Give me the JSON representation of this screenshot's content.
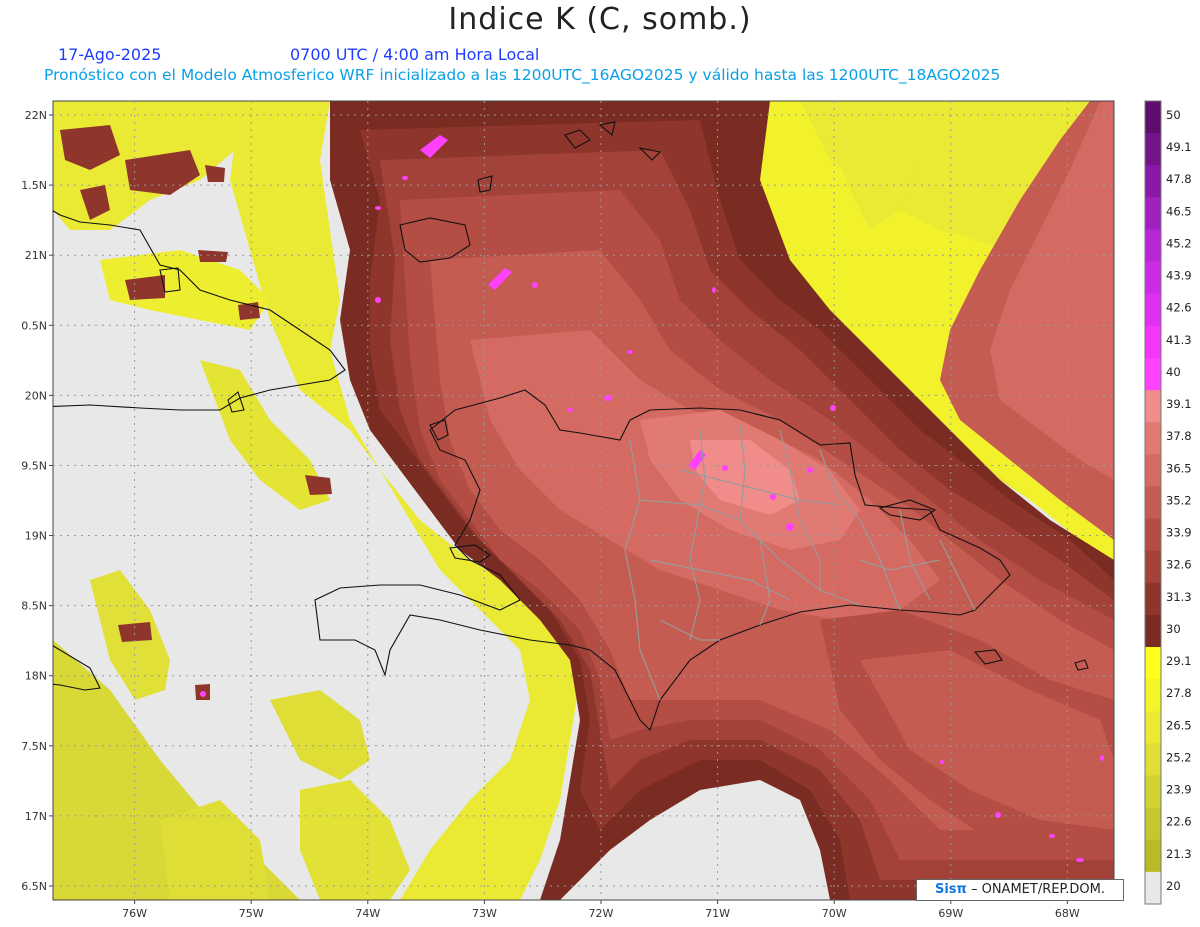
{
  "header": {
    "title": "Indice K (C, somb.)",
    "date": "17-Ago-2025",
    "time": "0700 UTC / 4:00 am Hora Local",
    "model_line": "Pronóstico con el Modelo Atmosferico WRF inicializado a las 1200UTC_16AGO2025 y válido hasta las  1200UTC_18AGO2025"
  },
  "map": {
    "lon_range": [
      -76.7,
      -67.6
    ],
    "lat_range": [
      16.4,
      22.1
    ],
    "lon_ticks": [
      {
        "value": -76,
        "label": "76W"
      },
      {
        "value": -75,
        "label": "75W"
      },
      {
        "value": -74,
        "label": "74W"
      },
      {
        "value": -73,
        "label": "73W"
      },
      {
        "value": -72,
        "label": "72W"
      },
      {
        "value": -71,
        "label": "71W"
      },
      {
        "value": -70,
        "label": "70W"
      },
      {
        "value": -69,
        "label": "69W"
      },
      {
        "value": -68,
        "label": "68W"
      }
    ],
    "lat_ticks": [
      {
        "value": 22,
        "label": "22N"
      },
      {
        "value": 21.5,
        "label": "1.5N"
      },
      {
        "value": 21,
        "label": "21N"
      },
      {
        "value": 20.5,
        "label": "0.5N"
      },
      {
        "value": 20,
        "label": "20N"
      },
      {
        "value": 19.5,
        "label": "9.5N"
      },
      {
        "value": 19,
        "label": "19N"
      },
      {
        "value": 18.5,
        "label": "8.5N"
      },
      {
        "value": 18,
        "label": "18N"
      },
      {
        "value": 17.5,
        "label": "7.5N"
      },
      {
        "value": 17,
        "label": "17N"
      },
      {
        "value": 16.5,
        "label": "6.5N"
      }
    ],
    "land_color": "#e8e8e8",
    "coast_color": "#111111",
    "province_color": "#9a9a9a",
    "grid_color": "#9a9a9a"
  },
  "colorbar": {
    "levels": [
      {
        "label": "50",
        "color": "#5e0c6e"
      },
      {
        "label": "49.1",
        "color": "#74148a"
      },
      {
        "label": "47.8",
        "color": "#8a1aa6"
      },
      {
        "label": "46.5",
        "color": "#a020c0"
      },
      {
        "label": "45.2",
        "color": "#b826d6"
      },
      {
        "label": "43.9",
        "color": "#cc2ce6"
      },
      {
        "label": "42.6",
        "color": "#e030f2"
      },
      {
        "label": "41.3",
        "color": "#f236fa"
      },
      {
        "label": "40",
        "color": "#fe40ff"
      },
      {
        "label": "39.1",
        "color": "#f08c8a"
      },
      {
        "label": "37.8",
        "color": "#e27a74"
      },
      {
        "label": "36.5",
        "color": "#d46a62"
      },
      {
        "label": "35.2",
        "color": "#c45c52"
      },
      {
        "label": "33.9",
        "color": "#b44e44"
      },
      {
        "label": "32.6",
        "color": "#a24238"
      },
      {
        "label": "31.3",
        "color": "#8e362c"
      },
      {
        "label": "30",
        "color": "#7a2c22"
      },
      {
        "label": "29.1",
        "color": "#ffff1a"
      },
      {
        "label": "27.8",
        "color": "#f4f42a"
      },
      {
        "label": "26.5",
        "color": "#eaea34"
      },
      {
        "label": "25.2",
        "color": "#dede36"
      },
      {
        "label": "23.9",
        "color": "#d2d232"
      },
      {
        "label": "22.6",
        "color": "#c6c62e"
      },
      {
        "label": "21.3",
        "color": "#baba26"
      },
      {
        "label": "20",
        "color": "#e8e8e8"
      }
    ]
  },
  "credit": {
    "brand": "Sisπ",
    "text": "– ONAMET/REP.DOM."
  }
}
